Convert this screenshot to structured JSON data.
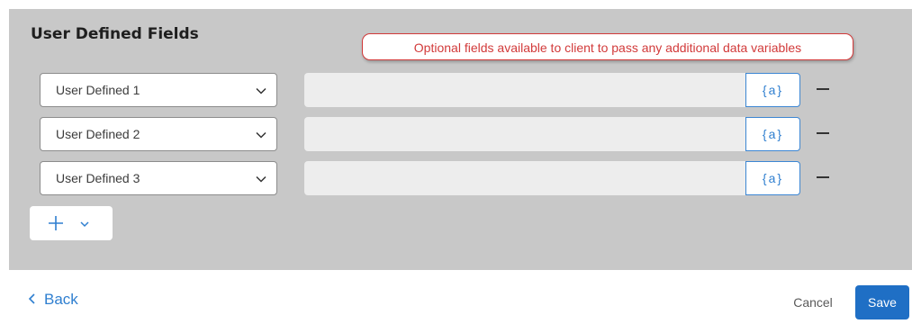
{
  "section": {
    "title": "User Defined Fields",
    "annotation": "Optional fields available to client to pass any additional data variables"
  },
  "rows": [
    {
      "field": "User Defined 1",
      "value": "",
      "var_label": "{a}"
    },
    {
      "field": "User Defined 2",
      "value": "",
      "var_label": "{a}"
    },
    {
      "field": "User Defined 3",
      "value": "",
      "var_label": "{a}"
    }
  ],
  "icons": {
    "dropdown": "chevron-down-icon",
    "add": "plus-icon",
    "remove": "minus-icon",
    "back": "chevron-left-icon"
  },
  "footer": {
    "back_label": "Back",
    "cancel_label": "Cancel",
    "save_label": "Save"
  },
  "colors": {
    "accent": "#1f6fc5",
    "annotation": "#d23a3a",
    "panel_bg": "#c8c8c8"
  }
}
